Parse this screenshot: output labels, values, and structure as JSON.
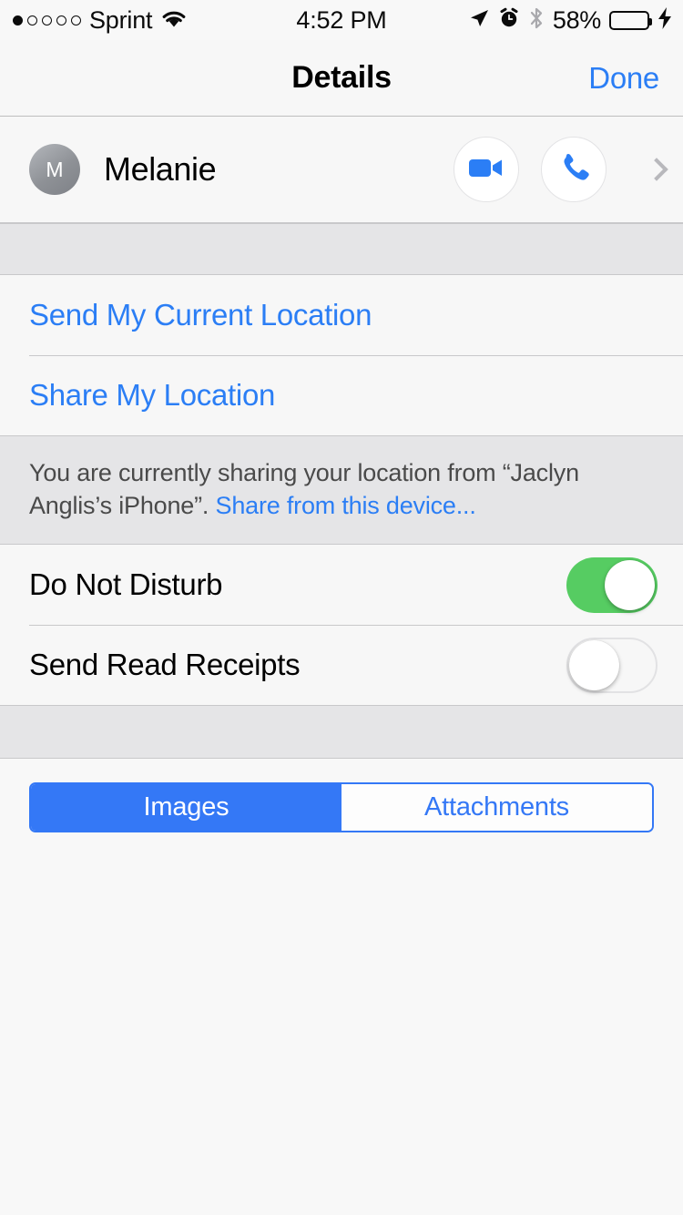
{
  "status_bar": {
    "signal_dots_total": 5,
    "signal_dots_filled": 1,
    "carrier": "Sprint",
    "wifi_icon": "wifi-icon",
    "time": "4:52 PM",
    "location_icon": "location-arrow-icon",
    "alarm_icon": "alarm-clock-icon",
    "bluetooth_icon": "bluetooth-icon",
    "battery_percent": "58%",
    "battery_level": 58,
    "battery_color": "#6FD36F",
    "charging_icon": "lightning-bolt-icon"
  },
  "nav": {
    "title": "Details",
    "done_label": "Done"
  },
  "contact": {
    "avatar_initial": "M",
    "name": "Melanie",
    "video_icon": "video-camera-icon",
    "phone_icon": "phone-handset-icon",
    "disclosure_icon": "chevron-right-icon"
  },
  "location_section": {
    "rows": [
      {
        "label": "Send My Current Location"
      },
      {
        "label": "Share My Location"
      }
    ],
    "note_text": "You are currently sharing your location from “Jaclyn Anglis’s iPhone”. ",
    "note_link": "Share from this device..."
  },
  "switch_section": {
    "rows": [
      {
        "label": "Do Not Disturb",
        "state": "on"
      },
      {
        "label": "Send Read Receipts",
        "state": "off"
      }
    ]
  },
  "segmented_control": {
    "options": [
      {
        "label": "Images",
        "selected": true
      },
      {
        "label": "Attachments",
        "selected": false
      }
    ]
  },
  "colors": {
    "tint_blue": "#2B7EF5",
    "segment_blue": "#3478F6",
    "switch_green": "#56CC62",
    "band_gray": "#E5E5E7",
    "row_bg": "#F7F7F7"
  }
}
